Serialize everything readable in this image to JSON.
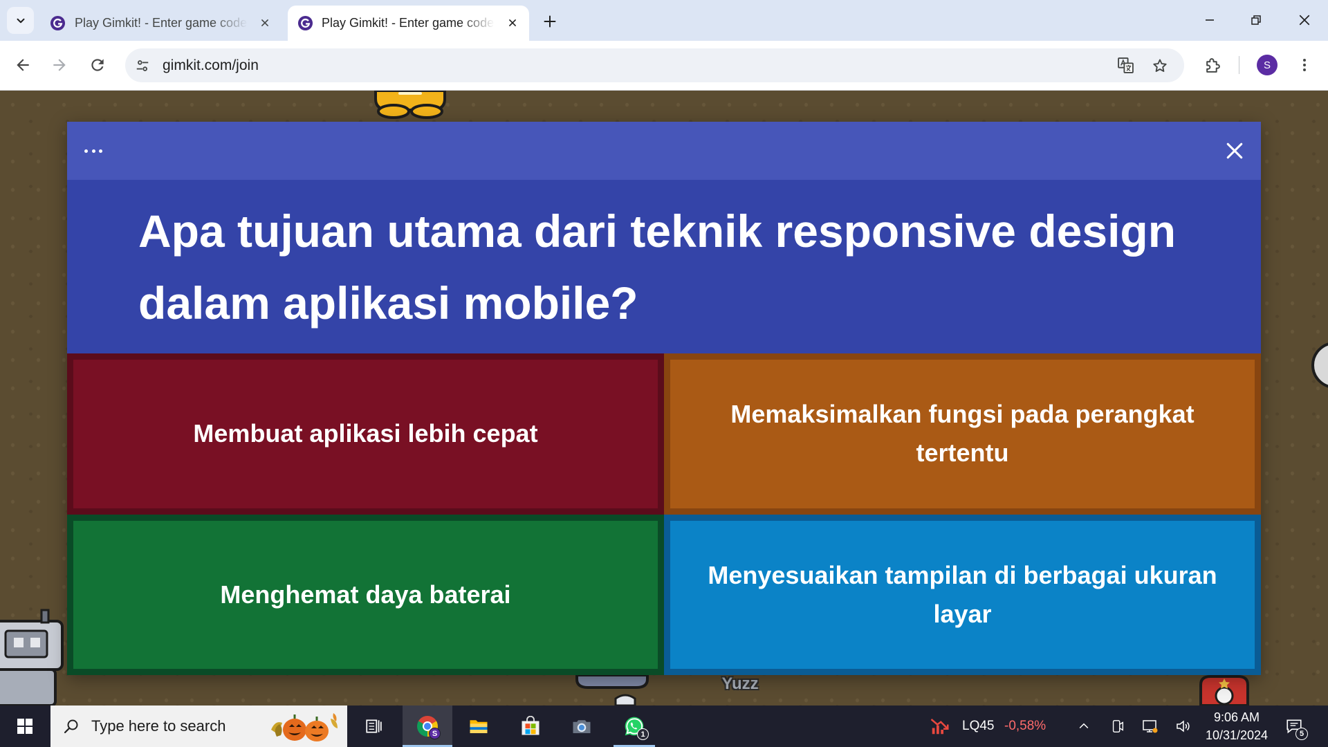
{
  "browser": {
    "tabs": [
      {
        "title": "Play Gimkit! - Enter game code",
        "favicon": "gimkit-icon",
        "active": false
      },
      {
        "title": "Play Gimkit! - Enter game code",
        "favicon": "gimkit-icon",
        "active": true
      }
    ],
    "url": "gimkit.com/join",
    "profile_initial": "S",
    "theme": {
      "tab_strip": "#dce5f4",
      "toolbar": "#ffffff",
      "omnibox": "#eef1f6",
      "profile": "#5b2ca3"
    }
  },
  "game": {
    "player_label": "Yuzz"
  },
  "question_modal": {
    "header_color": "#4756b9",
    "question_color": "#3444a8",
    "question": "Apa tujuan utama dari teknik responsive design dalam aplikasi mobile?",
    "answers": [
      {
        "text": "Membuat aplikasi lebih cepat",
        "fill": "#791024",
        "border": "#5b0c1b"
      },
      {
        "text": "Memaksimalkan fungsi pada perangkat tertentu",
        "fill": "#aa5a15",
        "border": "#884510"
      },
      {
        "text": "Menghemat daya baterai",
        "fill": "#127336",
        "border": "#0a4b27"
      },
      {
        "text": "Menyesuaikan tampilan di berbagai ukuran layar",
        "fill": "#0b83c7",
        "border": "#0a5c95"
      }
    ]
  },
  "taskbar": {
    "search_placeholder": "Type here to search",
    "pinned_apps": [
      "task-view-icon",
      "chrome-icon",
      "file-explorer-icon",
      "microsoft-store-icon",
      "camera-icon",
      "whatsapp-icon"
    ],
    "chrome_profile_badge": "S",
    "whatsapp_badge": "1",
    "stock": {
      "symbol": "LQ45",
      "change": "-0,58%",
      "change_color": "#ff6b6b"
    },
    "time": "9:06 AM",
    "date": "10/31/2024",
    "notification_count": "5"
  }
}
